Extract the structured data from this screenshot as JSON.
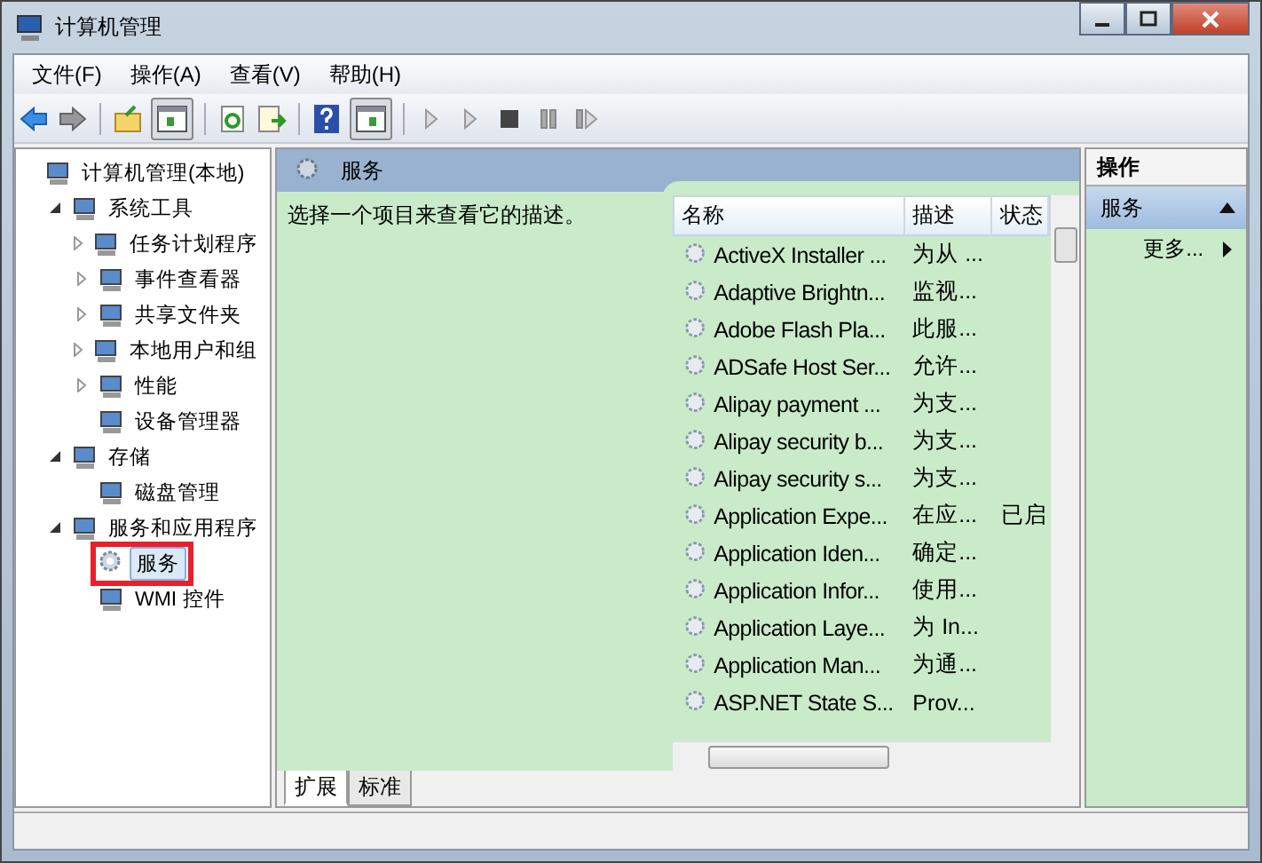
{
  "window": {
    "title": "计算机管理"
  },
  "menu": [
    "文件(F)",
    "操作(A)",
    "查看(V)",
    "帮助(H)"
  ],
  "tree": [
    {
      "label": "计算机管理(本地)",
      "selected": false,
      "highlighted": false,
      "children": [
        {
          "label": "系统工具",
          "expanded": true,
          "selected": false,
          "highlighted": false,
          "children": [
            {
              "label": "任务计划程序",
              "expanded": false,
              "selected": false,
              "highlighted": false
            },
            {
              "label": "事件查看器",
              "expanded": false,
              "selected": false,
              "highlighted": false
            },
            {
              "label": "共享文件夹",
              "expanded": false,
              "selected": false,
              "highlighted": false
            },
            {
              "label": "本地用户和组",
              "expanded": false,
              "selected": false,
              "highlighted": false
            },
            {
              "label": "性能",
              "expanded": false,
              "selected": false,
              "highlighted": false
            },
            {
              "label": "设备管理器",
              "selected": false,
              "highlighted": false
            }
          ]
        },
        {
          "label": "存储",
          "expanded": true,
          "selected": false,
          "highlighted": false,
          "children": [
            {
              "label": "磁盘管理",
              "selected": false,
              "highlighted": false
            }
          ]
        },
        {
          "label": "服务和应用程序",
          "expanded": true,
          "selected": false,
          "highlighted": false,
          "children": [
            {
              "label": "服务",
              "selected": true,
              "highlighted": true
            },
            {
              "label": "WMI 控件",
              "selected": false,
              "highlighted": false
            }
          ]
        }
      ]
    }
  ],
  "content": {
    "title": "服务",
    "description": "选择一个项目来查看它的描述。",
    "columns": [
      "名称",
      "描述",
      "状态"
    ],
    "rows": [
      {
        "name": "ActiveX Installer ...",
        "description": "为从 ..."
      },
      {
        "name": "Adaptive Brightn...",
        "description": "监视..."
      },
      {
        "name": "Adobe Flash Pla...",
        "description": "此服..."
      },
      {
        "name": "ADSafe Host Ser...",
        "description": "允许..."
      },
      {
        "name": "Alipay payment ...",
        "description": "为支..."
      },
      {
        "name": "Alipay security b...",
        "description": "为支..."
      },
      {
        "name": "Alipay security s...",
        "description": "为支..."
      },
      {
        "name": "Application Expe...",
        "description": "在应...",
        "status": "已启"
      },
      {
        "name": "Application Iden...",
        "description": "确定..."
      },
      {
        "name": "Application Infor...",
        "description": "使用..."
      },
      {
        "name": "Application Laye...",
        "description": "为 In..."
      },
      {
        "name": "Application Man...",
        "description": "为通..."
      },
      {
        "name": "ASP.NET State S...",
        "description": "Prov..."
      }
    ],
    "tabs": [
      {
        "label": "扩展",
        "selected": true
      },
      {
        "label": "标准",
        "selected": false
      }
    ]
  },
  "actions": {
    "title": "操作",
    "section": "服务",
    "items": [
      "更多..."
    ]
  }
}
